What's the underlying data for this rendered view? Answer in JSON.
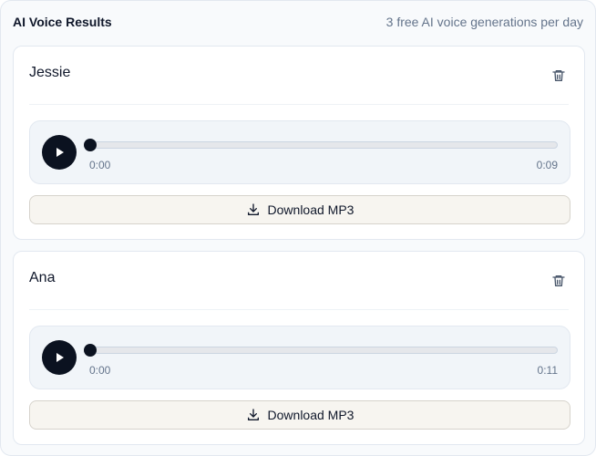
{
  "header": {
    "title": "AI Voice Results",
    "note": "3 free AI voice generations per day"
  },
  "results": [
    {
      "name": "Jessie",
      "current_time": "0:00",
      "duration": "0:09",
      "progress": 0,
      "download_label": "Download MP3"
    },
    {
      "name": "Ana",
      "current_time": "0:00",
      "duration": "0:11",
      "progress": 0,
      "download_label": "Download MP3"
    }
  ],
  "icons": {
    "delete": "trash-icon",
    "play": "play-icon",
    "download": "download-icon"
  },
  "colors": {
    "accent": "#0b1220",
    "muted_text": "#64748b",
    "download_bg": "#f7f5f0"
  }
}
